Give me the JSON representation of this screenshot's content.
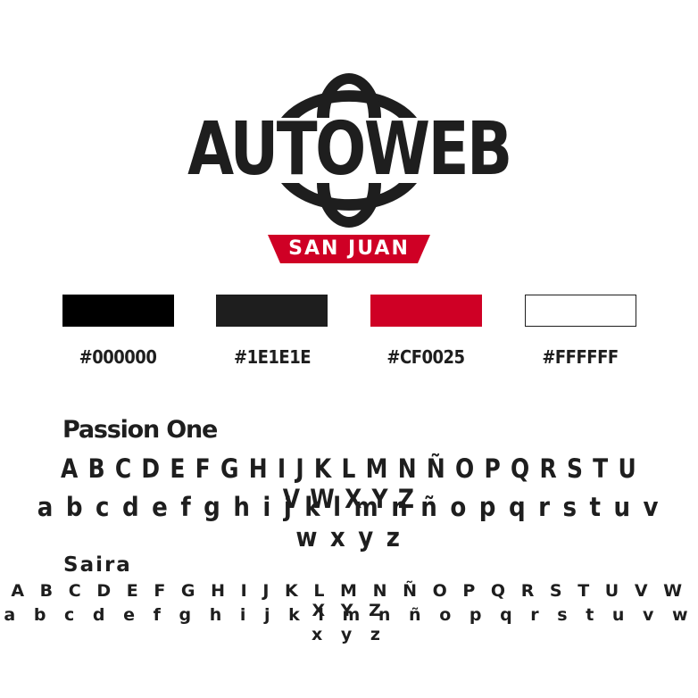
{
  "logo": {
    "wordmark": "AUTOWEB",
    "tagline": "SAN JUAN",
    "icon": "globe-icon",
    "colors": {
      "dark": "#1E1E1E",
      "accent": "#CF0025"
    }
  },
  "palette": [
    {
      "hex": "#000000",
      "label": "#000000"
    },
    {
      "hex": "#1E1E1E",
      "label": "#1E1E1E"
    },
    {
      "hex": "#CF0025",
      "label": "#CF0025"
    },
    {
      "hex": "#FFFFFF",
      "label": "#FFFFFF"
    }
  ],
  "typefaces": [
    {
      "name": "Passion One",
      "uppercase": "A B C D E F G H I J K L M N Ñ O P Q R S T U V W X Y Z",
      "lowercase": "a b c d e f g h i j k l m n ñ o p q r s t u v w x y z"
    },
    {
      "name": "Saira",
      "uppercase": "A B C D E F G H I J K L M N Ñ O P Q R S T U V W X Y Z",
      "lowercase": "a b c d e f g h i j k l m n ñ o p q r s t u v w x y z"
    }
  ]
}
